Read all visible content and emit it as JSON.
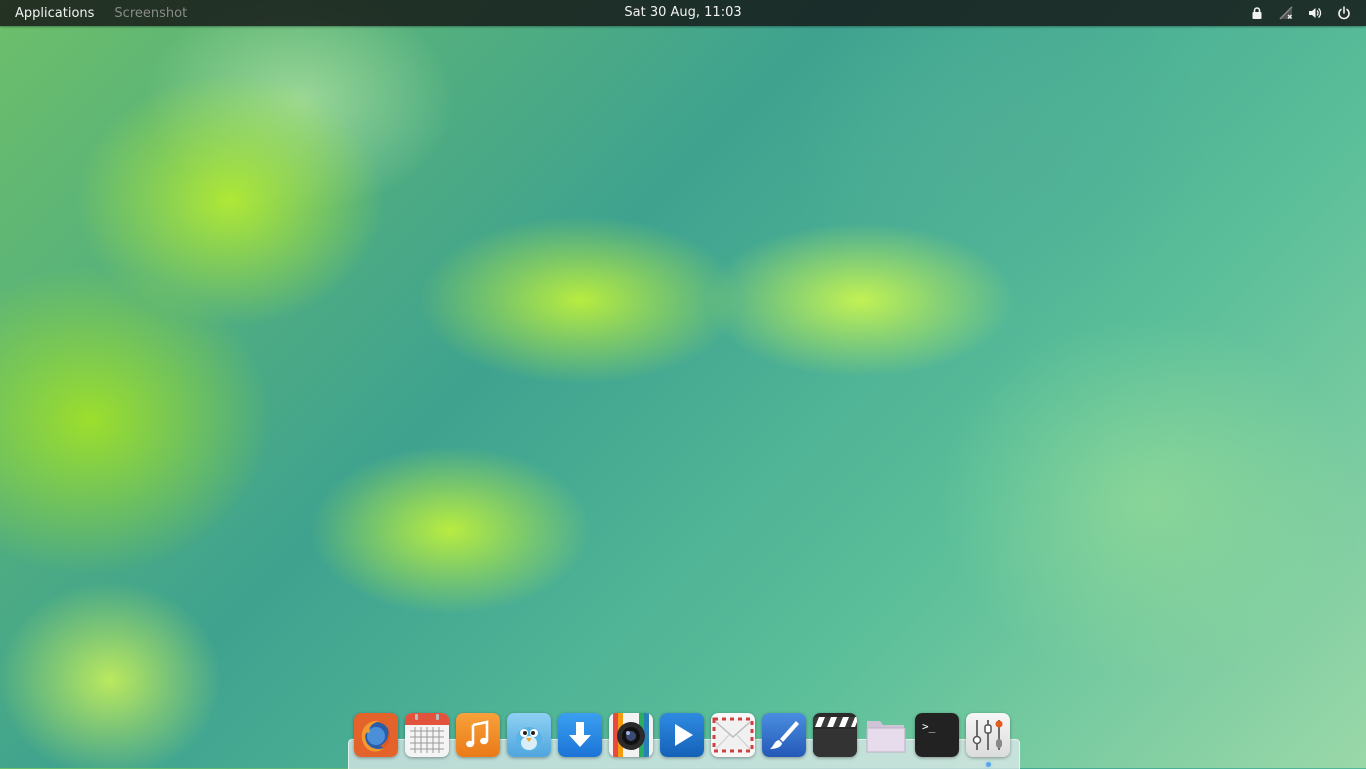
{
  "panel": {
    "applications_label": "Applications",
    "window_label": "Screenshot",
    "clock": "Sat 30 Aug, 11:03",
    "indicators": [
      "lock-icon",
      "network-disconnected-icon",
      "volume-icon",
      "power-icon"
    ]
  },
  "dock": {
    "items": [
      {
        "name": "firefox",
        "icon": "firefox-icon"
      },
      {
        "name": "calendar",
        "icon": "calendar-icon"
      },
      {
        "name": "music",
        "icon": "music-note-icon"
      },
      {
        "name": "twitter-client",
        "icon": "bird-icon"
      },
      {
        "name": "downloads",
        "icon": "download-arrow-icon"
      },
      {
        "name": "camera",
        "icon": "camera-lens-icon"
      },
      {
        "name": "video-player",
        "icon": "play-icon"
      },
      {
        "name": "mail",
        "icon": "envelope-icon"
      },
      {
        "name": "paint",
        "icon": "paintbrush-icon"
      },
      {
        "name": "video-editor",
        "icon": "clapperboard-icon"
      },
      {
        "name": "files",
        "icon": "folder-icon"
      },
      {
        "name": "terminal",
        "icon": "terminal-icon"
      },
      {
        "name": "settings",
        "icon": "sliders-icon"
      }
    ],
    "terminal_prompt": ">_",
    "active_item": "settings"
  },
  "colors": {
    "panel_bg": "#141414",
    "running_indicator": "#5ba3e8"
  }
}
